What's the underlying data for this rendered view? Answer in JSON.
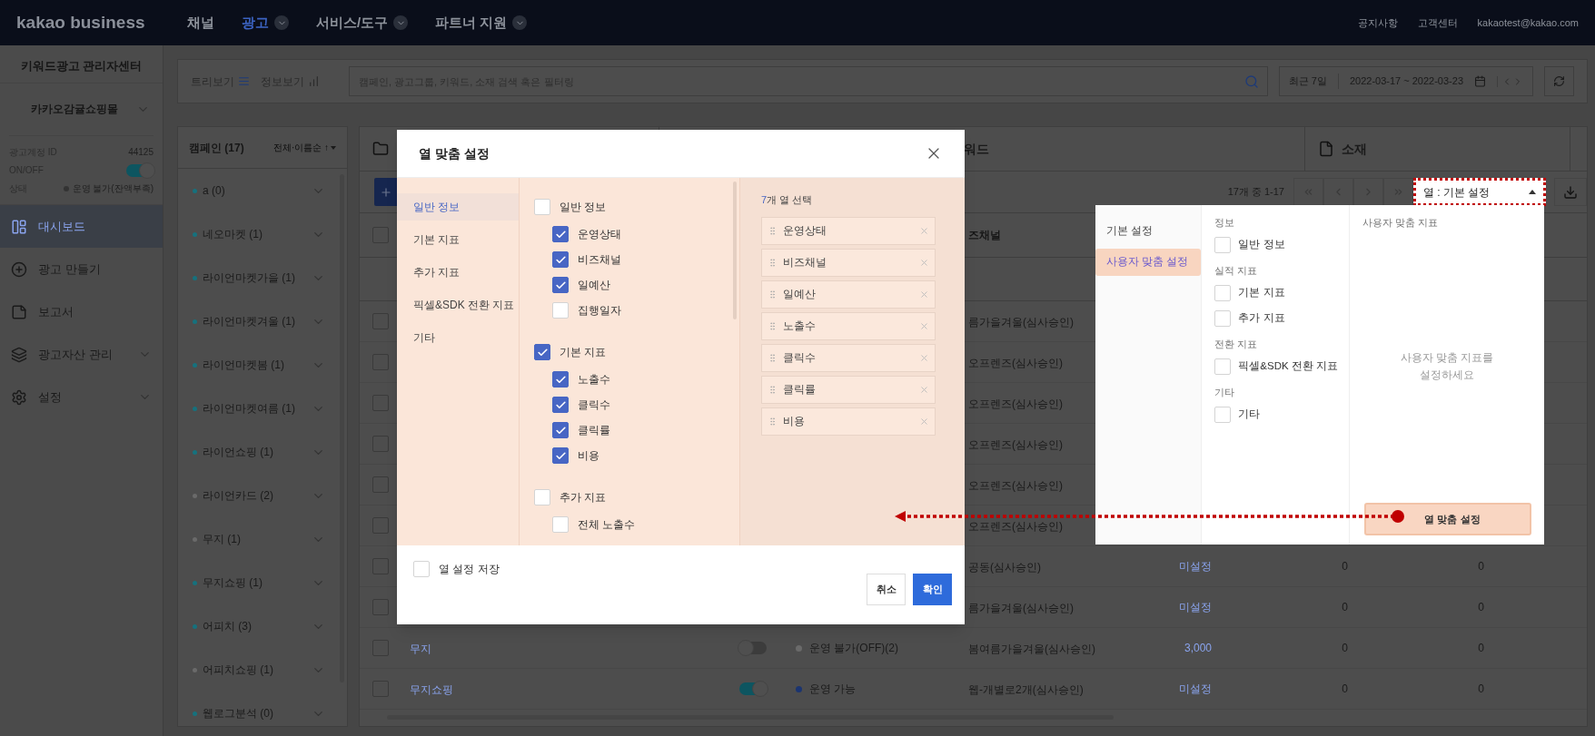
{
  "top_bar": {
    "logo": "kakao business",
    "nav": [
      {
        "label": "채널",
        "selected": false,
        "has_menu": false
      },
      {
        "label": "광고",
        "selected": true,
        "has_menu": true
      },
      {
        "label": "서비스/도구",
        "selected": false,
        "has_menu": true
      },
      {
        "label": "파트너 지원",
        "selected": false,
        "has_menu": true
      }
    ],
    "links": [
      "공지사항",
      "고객센터",
      "kakaotest@kakao.com"
    ]
  },
  "sidebar": {
    "title": "키워드광고 관리자센터",
    "account": "카카오감귤쇼핑몰",
    "account_id_label": "광고계정 ID",
    "account_id": "44125",
    "onoff_label": "ON/OFF",
    "on": true,
    "status_label": "상태",
    "status": "운영 불가(잔액부족)",
    "items": [
      {
        "label": "대시보드",
        "kind": "dashboard",
        "selected": true,
        "expandable": false
      },
      {
        "label": "광고 만들기",
        "kind": "create",
        "selected": false,
        "expandable": false
      },
      {
        "label": "보고서",
        "kind": "report",
        "selected": false,
        "expandable": false
      },
      {
        "label": "광고자산 관리",
        "kind": "assets",
        "selected": false,
        "expandable": true
      },
      {
        "label": "설정",
        "kind": "settings",
        "selected": false,
        "expandable": true
      }
    ]
  },
  "toolbar": {
    "tree_view": "트리보기",
    "info_view": "정보보기",
    "search": {
      "placeholder": "캠페인, 광고그룹, 키워드, 소재 검색 혹은 필터링"
    },
    "period": "최근 7일",
    "date_range": "2022-03-17 ~ 2022-03-23"
  },
  "campaigns": {
    "title": "캠페인 (17)",
    "sort": "전체·이름순 ↑",
    "items": [
      {
        "label": "a (0)",
        "color": "#16717d"
      },
      {
        "label": "네오마켓 (1)",
        "color": "#16717d"
      },
      {
        "label": "라이언마켓가을 (1)",
        "color": "#16717d"
      },
      {
        "label": "라이언마켓겨울 (1)",
        "color": "#16717d"
      },
      {
        "label": "라이언마켓봄 (1)",
        "color": "#16717d"
      },
      {
        "label": "라이언마켓여름 (1)",
        "color": "#16717d"
      },
      {
        "label": "라이언쇼핑 (1)",
        "color": "#16717d"
      },
      {
        "label": "라이언카드 (2)",
        "color": "#6a6a6a"
      },
      {
        "label": "무지 (1)",
        "color": "#6a6a6a"
      },
      {
        "label": "무지쇼핑 (1)",
        "color": "#16717d"
      },
      {
        "label": "어피치 (3)",
        "color": "#16717d"
      },
      {
        "label": "어피치쇼핑 (1)",
        "color": "#6a6a6a"
      },
      {
        "label": "웹로그분석 (0)",
        "color": "#16717d"
      }
    ]
  },
  "tabs": [
    "워드",
    "소재"
  ],
  "pagination": {
    "summary": "17개 중 1-17"
  },
  "column_selector": {
    "label": "열 : 기본 설정",
    "expanded": true
  },
  "table": {
    "header_checked": false,
    "channel_header": "즈채널",
    "rows": [
      {
        "checked": false,
        "channel": "름가을겨울(심사승인)"
      },
      {
        "checked": false,
        "channel": "오프렌즈(심사승인)"
      },
      {
        "checked": false,
        "channel": "오프렌즈(심사승인)"
      },
      {
        "checked": false,
        "channel": "오프렌즈(심사승인)"
      },
      {
        "checked": false,
        "channel": "오프렌즈(심사승인)"
      },
      {
        "checked": false,
        "channel": "오프렌즈(심사승인)"
      },
      {
        "checked": false,
        "channel": "공동(심사승인)",
        "column_6": "미설정",
        "column_7": "0",
        "column_8": "0"
      },
      {
        "checked": false,
        "channel": "름가을겨울(심사승인)",
        "column_6": "미설정",
        "column_7": "0",
        "column_8": "0"
      },
      {
        "checked": false,
        "name": "무지",
        "on": false,
        "status": "운영 불가(OFF)(2)",
        "color": "#6a6a6a",
        "channel": "봄여름가을겨울(심사승인)",
        "column_6": "3,000",
        "column_7": "0",
        "column_8": "0"
      },
      {
        "checked": false,
        "name": "무지쇼핑",
        "on": true,
        "status": "운영 가능",
        "color": "#1b3470",
        "channel": "웹-개별로2개(심사승인)",
        "column_6": "미설정",
        "column_7": "0",
        "column_8": "0"
      }
    ]
  },
  "modal": {
    "title": "열 맞춤 설정",
    "nav": [
      {
        "label": "일반 정보",
        "selected": true
      },
      {
        "label": "기본 지표",
        "selected": false
      },
      {
        "label": "추가 지표",
        "selected": false
      },
      {
        "label": "픽셀&SDK 전환 지표",
        "selected": false
      },
      {
        "label": "기타",
        "selected": false
      }
    ],
    "groups": [
      {
        "label": "일반 정보",
        "checked": false,
        "items": [
          {
            "label": "운영상태",
            "checked": true
          },
          {
            "label": "비즈채널",
            "checked": true
          },
          {
            "label": "일예산",
            "checked": true
          },
          {
            "label": "집행일자",
            "checked": false
          }
        ]
      },
      {
        "label": "기본 지표",
        "checked": true,
        "items": [
          {
            "label": "노출수",
            "checked": true
          },
          {
            "label": "클릭수",
            "checked": true
          },
          {
            "label": "클릭률",
            "checked": true
          },
          {
            "label": "비용",
            "checked": true
          }
        ]
      },
      {
        "label": "추가 지표",
        "checked": false,
        "items": [
          {
            "label": "전체 노출수",
            "checked": false
          }
        ]
      }
    ],
    "selected_count": "7",
    "selected_caption": "개 열 선택",
    "selected_columns": [
      "운영상태",
      "비즈채널",
      "일예산",
      "노출수",
      "클릭수",
      "클릭률",
      "비용"
    ],
    "save": {
      "label": "열 설정 저장",
      "checked": false
    },
    "buttons": [
      {
        "label": "취소",
        "kind": "secondary"
      },
      {
        "label": "확인",
        "kind": "primary"
      }
    ]
  },
  "column_menu": {
    "presets": [
      {
        "label": "기본 설정",
        "selected": false
      },
      {
        "label": "사용자 맞춤 설정",
        "selected": true
      }
    ],
    "sections": [
      {
        "title": "정보",
        "items": [
          {
            "label": "일반 정보",
            "checked": false
          }
        ]
      },
      {
        "title": "실적 지표",
        "items": [
          {
            "label": "기본 지표",
            "checked": false
          },
          {
            "label": "추가 지표",
            "checked": false
          }
        ]
      },
      {
        "title": "전환 지표",
        "items": [
          {
            "label": "픽셀&SDK 전환 지표",
            "checked": false
          }
        ]
      },
      {
        "title": "기타",
        "items": [
          {
            "label": "기타",
            "checked": false
          }
        ]
      }
    ],
    "custom_title": "사용자 맞춤 지표",
    "empty_message": "사용자 맞춤 지표를 설정하세요",
    "button": "열 맞춤 설정"
  }
}
